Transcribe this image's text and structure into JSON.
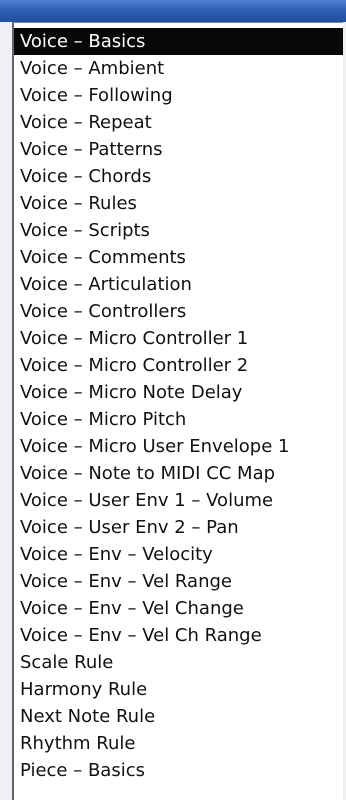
{
  "list": {
    "items": [
      {
        "label": "Voice – Basics",
        "selected": true
      },
      {
        "label": "Voice – Ambient"
      },
      {
        "label": "Voice – Following"
      },
      {
        "label": "Voice – Repeat"
      },
      {
        "label": "Voice – Patterns"
      },
      {
        "label": "Voice – Chords"
      },
      {
        "label": "Voice – Rules"
      },
      {
        "label": "Voice – Scripts"
      },
      {
        "label": "Voice – Comments"
      },
      {
        "label": "Voice – Articulation"
      },
      {
        "label": "Voice – Controllers"
      },
      {
        "label": "Voice – Micro Controller 1"
      },
      {
        "label": "Voice – Micro Controller 2"
      },
      {
        "label": "Voice – Micro Note Delay"
      },
      {
        "label": "Voice – Micro Pitch"
      },
      {
        "label": "Voice – Micro User Envelope 1"
      },
      {
        "label": "Voice – Note to MIDI CC Map"
      },
      {
        "label": "Voice – User Env 1 – Volume"
      },
      {
        "label": "Voice – User Env 2 – Pan"
      },
      {
        "label": "Voice – Env – Velocity"
      },
      {
        "label": "Voice – Env – Vel Range"
      },
      {
        "label": "Voice – Env – Vel Change"
      },
      {
        "label": "Voice – Env – Vel Ch Range"
      },
      {
        "label": "Scale Rule"
      },
      {
        "label": "Harmony Rule"
      },
      {
        "label": "Next Note Rule"
      },
      {
        "label": "Rhythm Rule"
      },
      {
        "label": "Piece – Basics"
      }
    ]
  }
}
